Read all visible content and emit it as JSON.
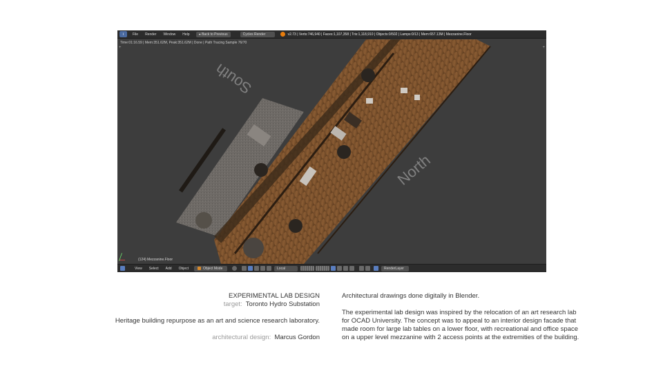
{
  "blender": {
    "menu": [
      "File",
      "Render",
      "Window",
      "Help"
    ],
    "back_button": "Back to Previous",
    "render_engine": "Cycles Render",
    "stats": "v2.73 | Verts:746,940 | Faces:1,107,358 | Tris:1,118,910 | Objects:0/502 | Lamps:0/13 | Mem:657.13M | Mezzanine.Floor",
    "render_info": "Time:01:16.59 | Mem:351.62M, Peak:351.62M | Done | Path Tracing Sample 76/70",
    "frame_label": "(124) Mezzanine.Floor",
    "compass_south": "South",
    "compass_north": "North",
    "bottom_menu": [
      "View",
      "Select",
      "Add",
      "Object"
    ],
    "mode": "Object Mode",
    "pivot": "Local",
    "render_layer": "RenderLayer"
  },
  "caption": {
    "title": "EXPERIMENTAL LAB DESIGN",
    "target_label": "target:",
    "target_value": "Toronto Hydro Substation",
    "subtitle": "Heritage building repurpose as an art and science research laboratory.",
    "designer_label": "architectural design:",
    "designer_value": "Marcus Gordon"
  },
  "description": {
    "line1": "Architectural drawings done digitally in Blender.",
    "paragraph": "The experimental lab design was inspired by the relocation of an art research lab for OCAD University.  The concept was to appeal to an interior design facade that made room for large lab tables on a lower floor, with recreational and office space on a upper level mezzanine with 2 access points at the extremities of the building."
  }
}
